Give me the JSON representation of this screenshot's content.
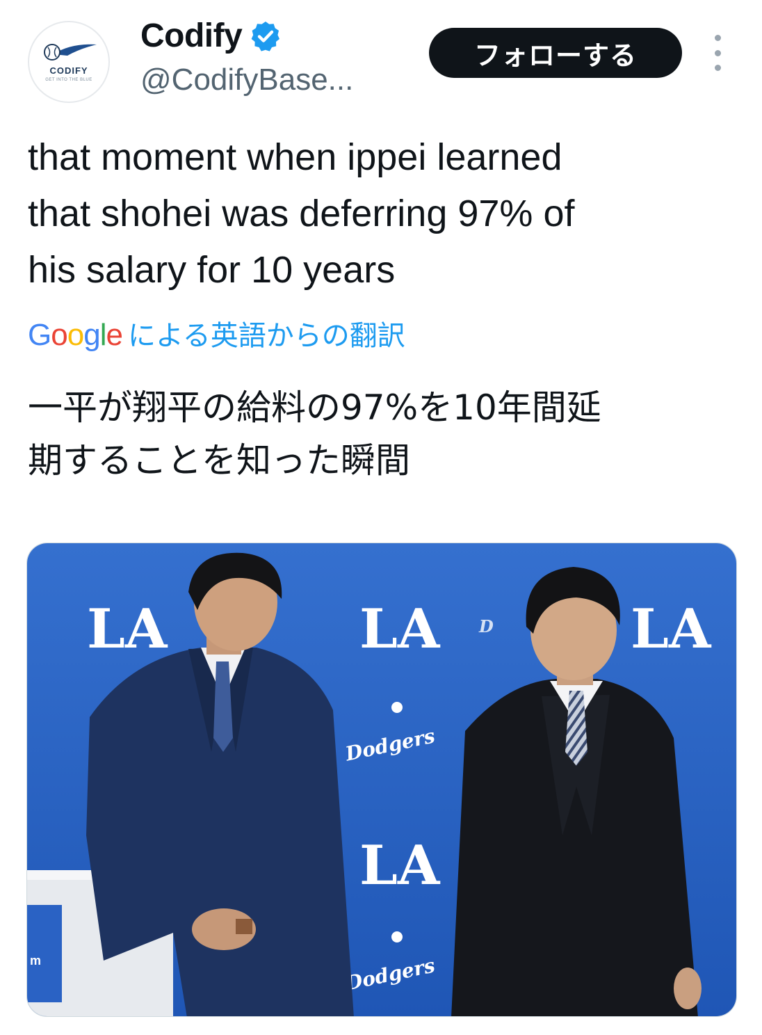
{
  "author": {
    "display_name": "Codify",
    "handle": "@CodifyBase...",
    "verified": true,
    "avatar": {
      "logo_text": "CODIFY",
      "tagline": "GET INTO THE BLUE"
    }
  },
  "actions": {
    "follow_label": "フォローする",
    "more_icon": "more-vertical-icon"
  },
  "tweet": {
    "text_lines": [
      "that moment when ippei learned",
      "that shohei was deferring 97% of",
      "his salary for 10 years"
    ],
    "translation": {
      "provider_logo": "Google",
      "label": "による英語からの翻訳",
      "text_lines": [
        "一平が翔平の給料の97%を10年間延",
        "期することを知った瞬間"
      ]
    }
  },
  "media": {
    "backdrop_marks": [
      "LA",
      "LA",
      "LA",
      "LA",
      "Dodgers",
      "Dodgers"
    ],
    "colors": {
      "backdrop": "#2a62c4",
      "suit_left": "#1e3360",
      "suit_right": "#15171c"
    }
  },
  "colors": {
    "text": "#0f1419",
    "secondary": "#536471",
    "link": "#1d9bf0",
    "follow_bg": "#0f1419",
    "verified": "#1d9bf0"
  }
}
